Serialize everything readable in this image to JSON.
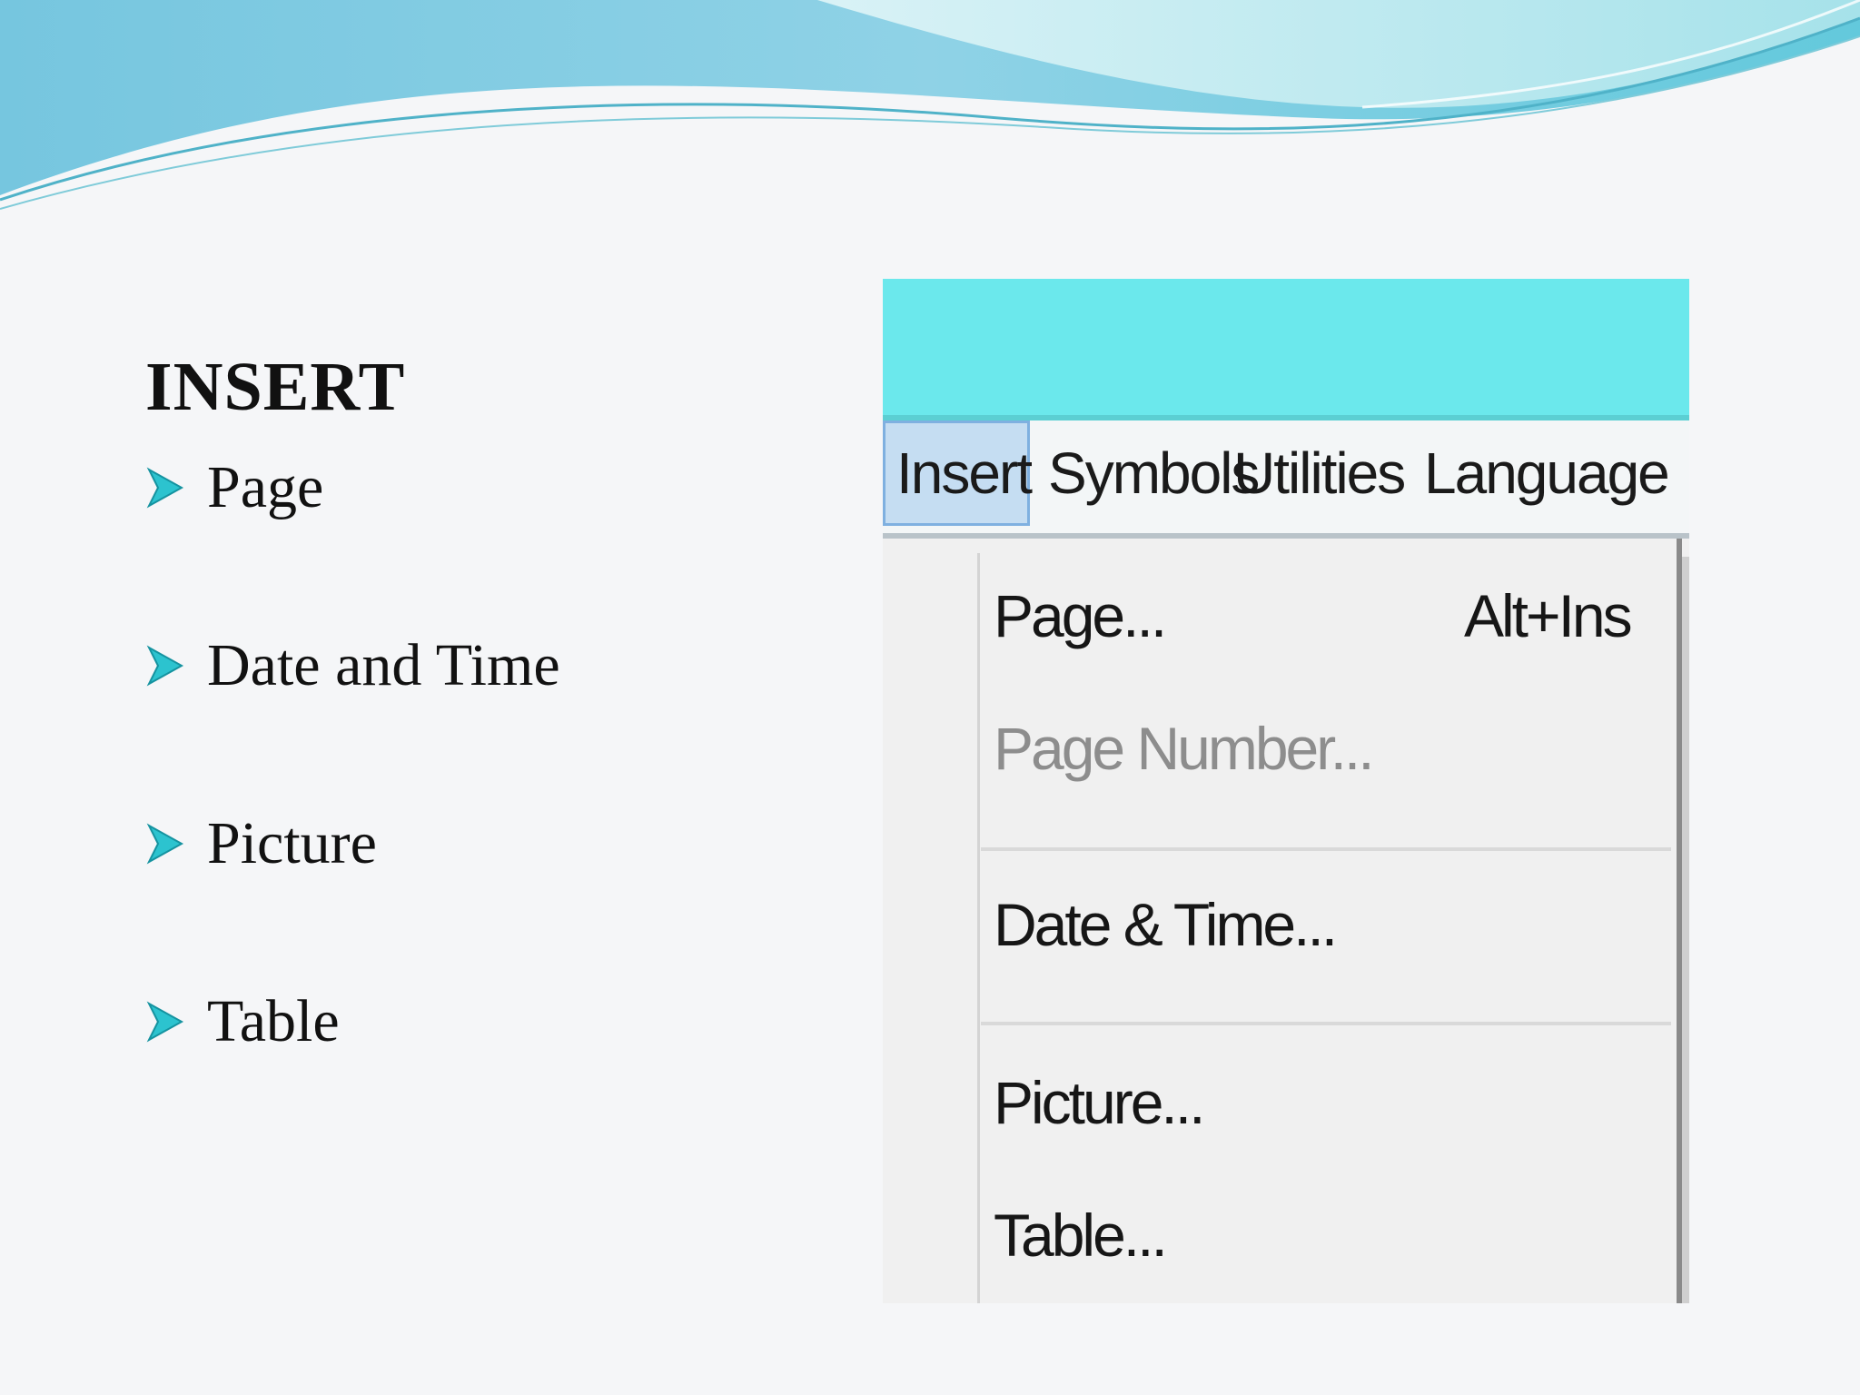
{
  "slide": {
    "title": "INSERT",
    "bullets": [
      {
        "label": "Page"
      },
      {
        "label": "Date and Time"
      },
      {
        "label": "Picture"
      },
      {
        "label": "Table"
      }
    ]
  },
  "menu": {
    "tabs": [
      {
        "label": "Insert",
        "active": true
      },
      {
        "label": "Symbols"
      },
      {
        "label": "Utilities"
      },
      {
        "label": "Language"
      }
    ],
    "items": [
      {
        "label": "Page...",
        "shortcut": "Alt+Ins"
      },
      {
        "label": "Page Number...",
        "disabled": true
      },
      {
        "label": "Date & Time..."
      },
      {
        "label": "Picture..."
      },
      {
        "label": "Table..."
      }
    ]
  },
  "colors": {
    "titlebar": "#6be8ec",
    "active_tab": "#c5ddf2",
    "bullet_arrow": "#2cc3cf",
    "wave_light": "#bfeaf0",
    "wave_dark": "#5fc6d9"
  }
}
